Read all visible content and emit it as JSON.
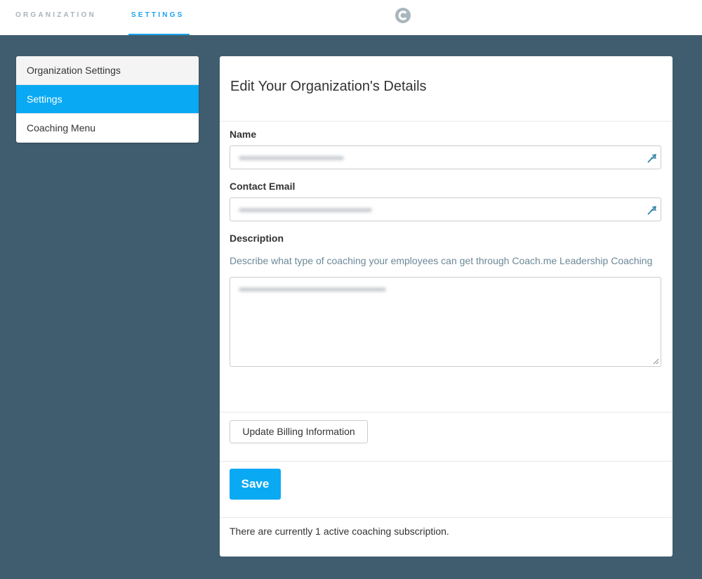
{
  "topnav": {
    "tabs": [
      {
        "label": "ORGANIZATION"
      },
      {
        "label": "SETTINGS",
        "active": true
      }
    ],
    "accent": "#1aa3f2"
  },
  "sidebar": {
    "items": [
      {
        "label": "Organization Settings",
        "kind": "header"
      },
      {
        "label": "Settings",
        "kind": "active"
      },
      {
        "label": "Coaching Menu",
        "kind": "normal"
      }
    ],
    "active_color": "#09a9f4"
  },
  "panel": {
    "title": "Edit Your Organization's Details",
    "name": {
      "label": "Name",
      "value_redacted": true,
      "icon": "edit-pen-icon"
    },
    "email": {
      "label": "Contact Email",
      "value_redacted": true,
      "icon": "edit-pen-icon"
    },
    "description": {
      "label": "Description",
      "help": "Describe what type of coaching your employees can get through Coach.me Leadership Coaching",
      "value_redacted": true
    },
    "billing_button": "Update Billing Information",
    "save_button": "Save",
    "footer_note": "There are currently 1 active coaching subscription."
  },
  "colors": {
    "background": "#3f5d6e",
    "primary_button": "#09a9f4"
  }
}
